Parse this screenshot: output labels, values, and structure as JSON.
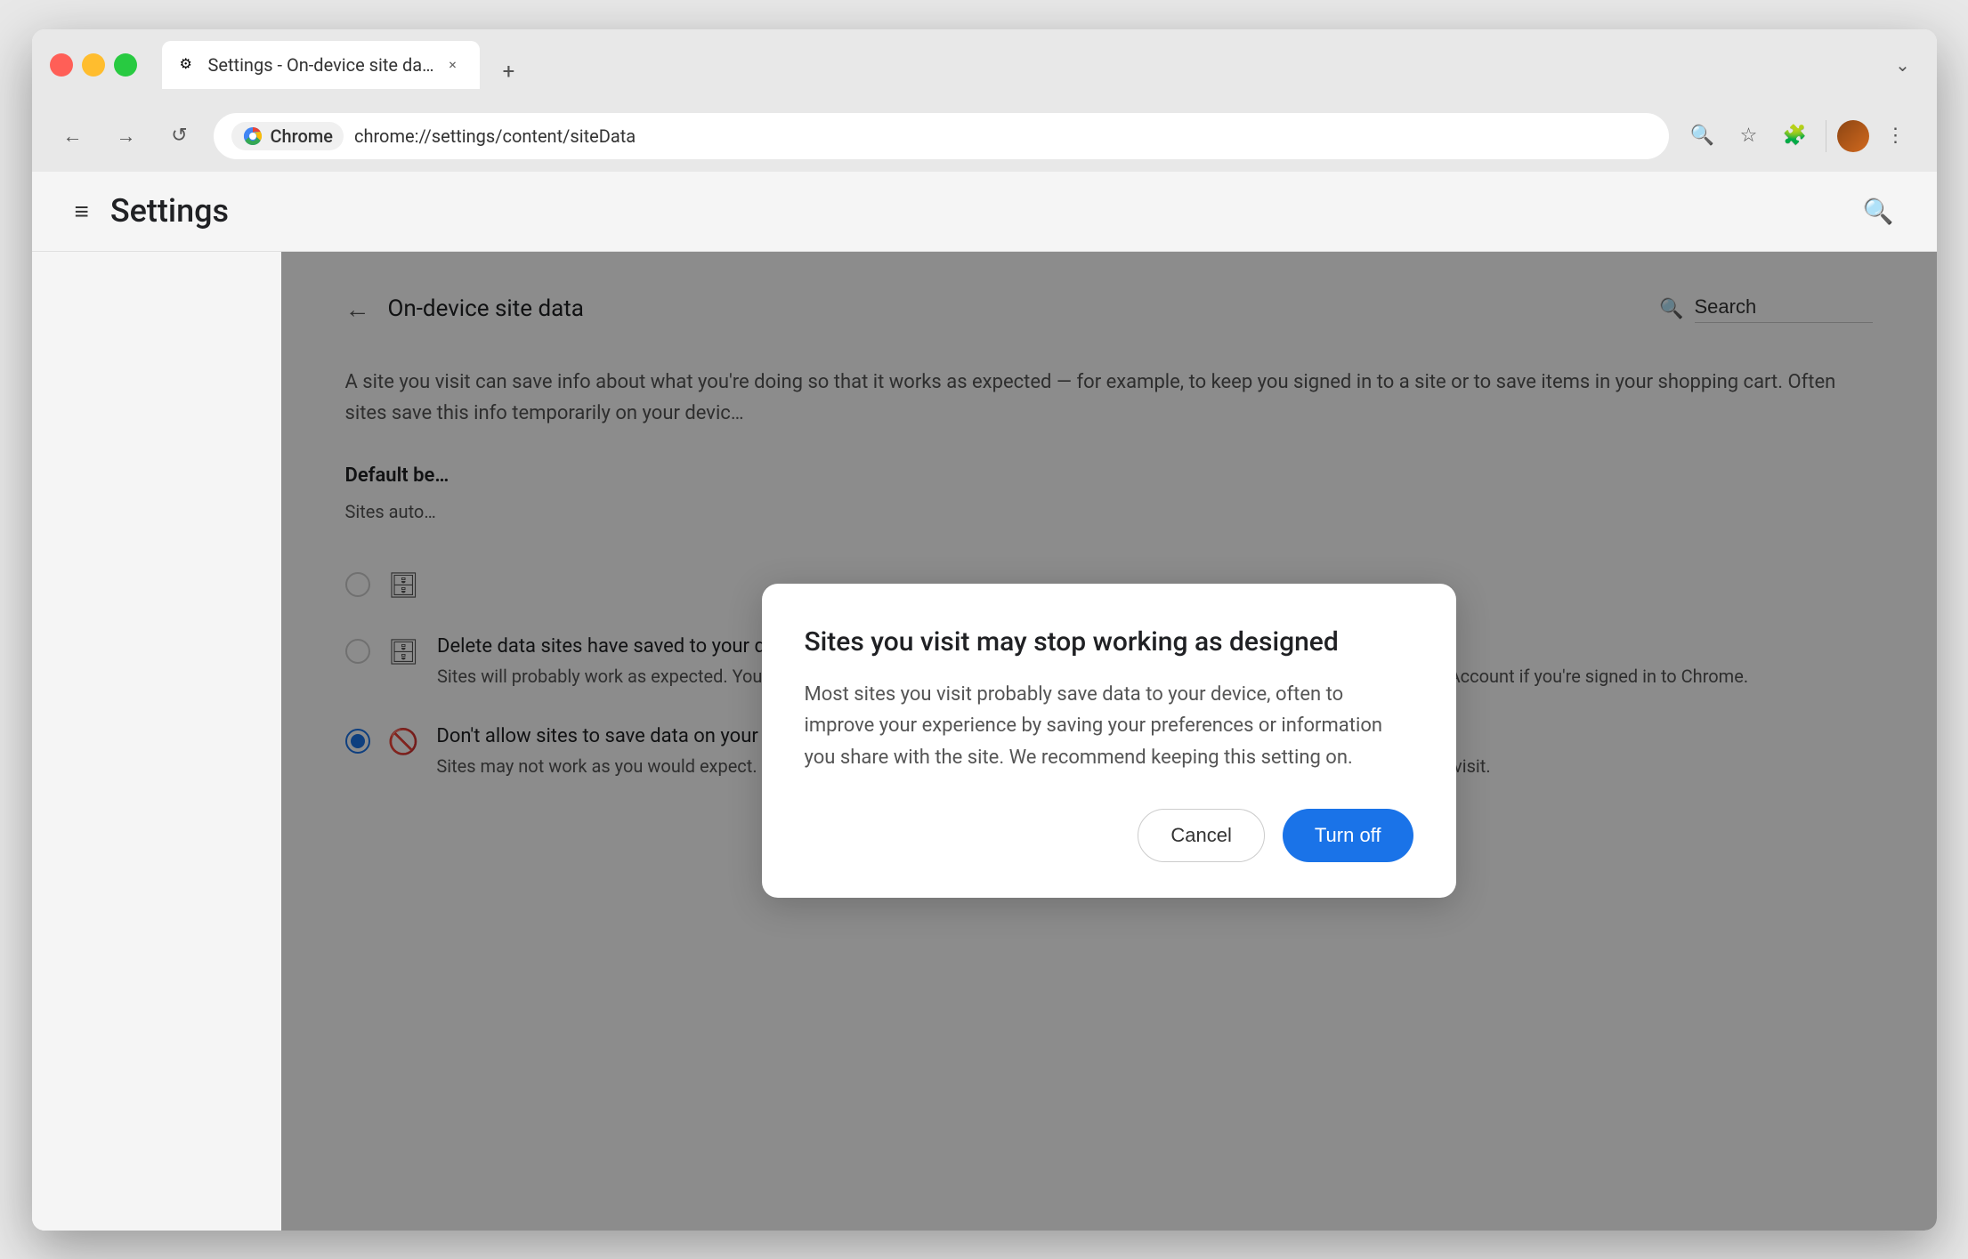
{
  "browser": {
    "tab": {
      "favicon": "⚙",
      "title": "Settings - On-device site da…",
      "close_label": "×"
    },
    "new_tab_label": "+",
    "window_btn_label": "⌄",
    "nav": {
      "back_label": "←",
      "forward_label": "→",
      "reload_label": "↺"
    },
    "address_bar": {
      "chrome_label": "Chrome",
      "url": "chrome://settings/content/siteData"
    },
    "toolbar_icons": {
      "zoom_label": "🔍",
      "bookmark_label": "☆",
      "extensions_label": "🧩",
      "menu_label": "⋮"
    }
  },
  "settings": {
    "header": {
      "menu_label": "≡",
      "title": "Settings",
      "search_label": "🔍"
    },
    "page": {
      "title": "On-device site data",
      "search_placeholder": "Search",
      "back_label": "←",
      "description": "A site you visit can save info about what you're doing so that it works as expected — for example, to keep you signed in to a site or to save items in your shopping cart. Often sites save this info temporarily on your devic…",
      "section_label": "Default be…",
      "section_sublabel": "Sites auto…",
      "options": [
        {
          "id": "option1",
          "selected": false,
          "icon": "🗄",
          "title": ""
        },
        {
          "id": "option2",
          "selected": false,
          "icon": "🗄",
          "title": "Delete data sites have saved to your device when you close all windows",
          "desc": "Sites will probably work as expected. You'll be signed out of most sites when you close all Chrome windows, except your Google Account if you're signed in to Chrome."
        },
        {
          "id": "option3",
          "selected": true,
          "icon": "🚫",
          "title": "Don't allow sites to save data on your device (not recommended)",
          "desc": "Sites may not work as you would expect. Choose this option if you don't want to leave information on your device about sites you visit."
        }
      ]
    }
  },
  "dialog": {
    "title": "Sites you visit may stop working as designed",
    "body": "Most sites you visit probably save data to your device, often to improve your experience by saving your preferences or information you share with the site. We recommend keeping this setting on.",
    "cancel_label": "Cancel",
    "confirm_label": "Turn off"
  }
}
